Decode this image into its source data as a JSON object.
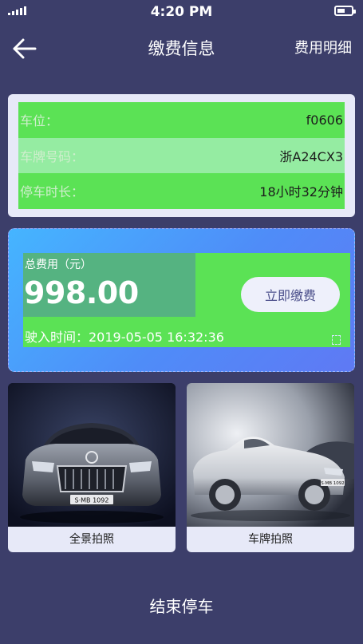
{
  "status_bar": {
    "time": "4:20 PM",
    "signal_icon": "signal-icon",
    "battery_icon": "battery-icon"
  },
  "nav": {
    "back_icon": "arrow-left-icon",
    "title": "缴费信息",
    "detail_link": "费用明细"
  },
  "parking_info": {
    "rows": [
      {
        "label": "车位：",
        "value": "f0606"
      },
      {
        "label": "车牌号码：",
        "value": "浙A24CX3"
      },
      {
        "label": "停车时长：",
        "value": "18小时32分钟"
      }
    ]
  },
  "fee": {
    "label": "总费用（元）",
    "amount": "998.00",
    "pay_button": "立即缴费",
    "entry_time": "驶入时间：2019-05-05  16:32:36"
  },
  "photos": [
    {
      "caption": "全景拍照",
      "plate_text": "S·MB 1092"
    },
    {
      "caption": "车牌拍照",
      "plate_text": "S·MB 1092"
    }
  ],
  "end_button": "结束停车",
  "colors": {
    "background": "#3c3e6a",
    "card": "#e7e9f8",
    "highlight_green": "#5be255",
    "fee_gradient_start": "#45b5ff",
    "fee_gradient_end": "#5f79f4"
  }
}
